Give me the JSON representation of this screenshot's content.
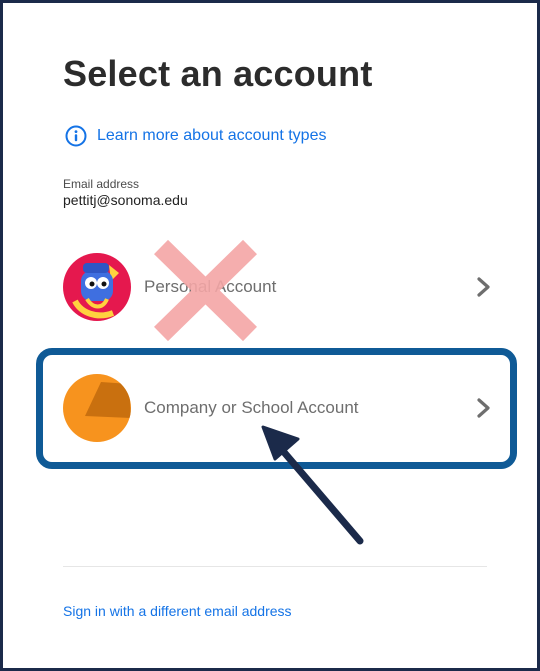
{
  "page": {
    "title": "Select an account",
    "learn_more": "Learn more about account types",
    "email_label": "Email address",
    "email_value": "pettitj@sonoma.edu",
    "alt_signin": "Sign in with a different email address"
  },
  "accounts": [
    {
      "label": "Personal Account",
      "avatar_icon": "cartoon-avatar",
      "annotation": "red-x-icon"
    },
    {
      "label": "Company or School Account",
      "avatar_icon": "org-avatar",
      "annotation": "highlight-box-and-arrow"
    }
  ],
  "colors": {
    "link": "#1473e6",
    "title": "#2c2c2c",
    "highlight": "#0f5a96",
    "red_x": "#f4a6a6",
    "arrow": "#1b2a4a",
    "org_avatar": "#f7931e",
    "personal_avatar_bg": "#e5184e"
  },
  "icons": {
    "info": "info-circle-icon",
    "chevron": "chevron-right-icon"
  }
}
